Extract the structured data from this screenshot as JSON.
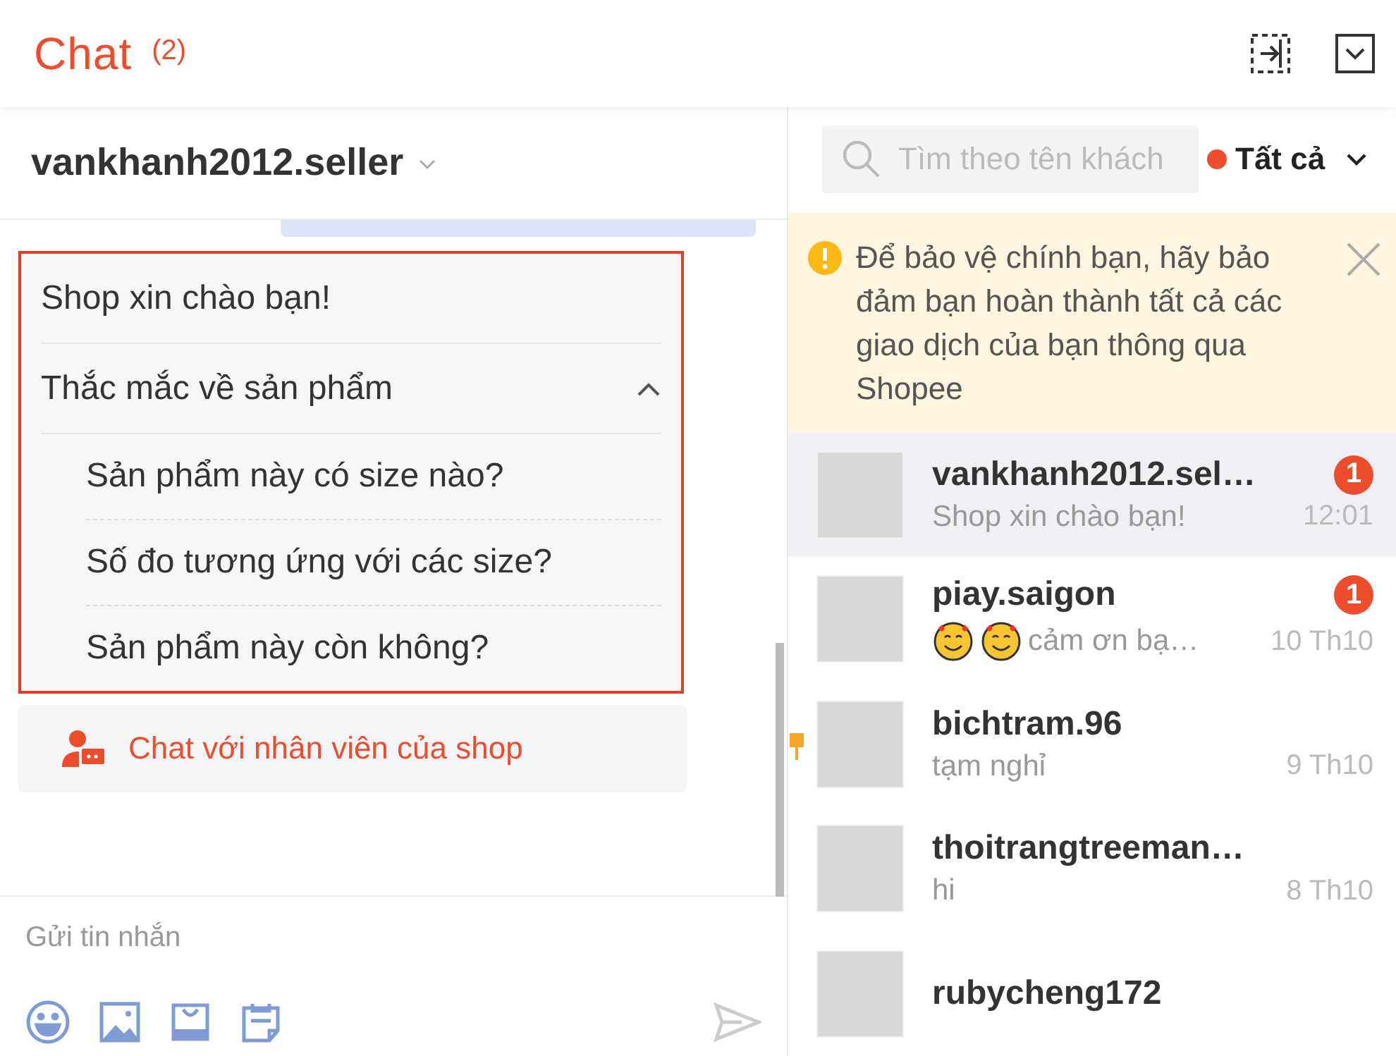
{
  "header": {
    "title": "Chat",
    "count": "(2)"
  },
  "conversation": {
    "name": "vankhanh2012.seller"
  },
  "quick_replies": {
    "greeting": "Shop xin chào bạn!",
    "section": {
      "title": "Thắc mắc về sản phẩm",
      "expanded": true,
      "questions": [
        "Sản phẩm này có size nào?",
        "Số đo tương ứng với các size?",
        "Sản phẩm này còn không?"
      ]
    }
  },
  "staff_button": "Chat với nhân viên của shop",
  "composer": {
    "placeholder": "Gửi tin nhắn"
  },
  "search": {
    "placeholder": "Tìm theo tên khách"
  },
  "filter": {
    "label": "Tất cả"
  },
  "notice": "Để bảo vệ chính bạn, hãy bảo đảm bạn hoàn thành tất cả các giao dịch của bạn thông qua Shopee",
  "chats": [
    {
      "name": "vankhanh2012.sel…",
      "preview": "Shop xin chào bạn!",
      "time": "12:01",
      "badge": "1",
      "selected": true,
      "pinned": false,
      "has_emoji": false
    },
    {
      "name": "piay.saigon",
      "preview": "cảm ơn bạ…",
      "time": "10 Th10",
      "badge": "1",
      "selected": false,
      "pinned": false,
      "has_emoji": true
    },
    {
      "name": "bichtram.96",
      "preview": "tạm nghỉ",
      "time": "9 Th10",
      "selected": false,
      "pinned": true,
      "has_emoji": false
    },
    {
      "name": "thoitrangtreeman…",
      "preview": "hi",
      "time": "8 Th10",
      "selected": false,
      "pinned": false,
      "has_emoji": false
    },
    {
      "name": "rubycheng172",
      "selected": false,
      "pinned": false,
      "has_emoji": false
    }
  ]
}
